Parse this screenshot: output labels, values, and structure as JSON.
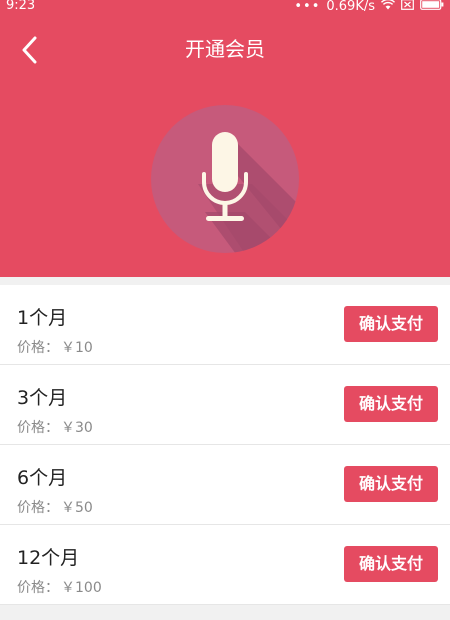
{
  "status_bar": {
    "time": "9:23",
    "network_speed": "0.69K/s",
    "icons": [
      "more-dots-icon",
      "wifi-icon",
      "sim-icon",
      "battery-icon"
    ]
  },
  "header": {
    "title": "开通会员",
    "back_icon": "chevron-left-icon",
    "hero_icon": "microphone-icon"
  },
  "colors": {
    "accent": "#e54b61",
    "badge_circle": "#c65a7b",
    "mic_fill": "#fdf6e6"
  },
  "plans": [
    {
      "name": "1个月",
      "price_label": "价格：",
      "price_value": "￥10",
      "button_label": "确认支付"
    },
    {
      "name": "3个月",
      "price_label": "价格：",
      "price_value": "￥30",
      "button_label": "确认支付"
    },
    {
      "name": "6个月",
      "price_label": "价格：",
      "price_value": "￥50",
      "button_label": "确认支付"
    },
    {
      "name": "12个月",
      "price_label": "价格：",
      "price_value": "￥100",
      "button_label": "确认支付"
    }
  ]
}
